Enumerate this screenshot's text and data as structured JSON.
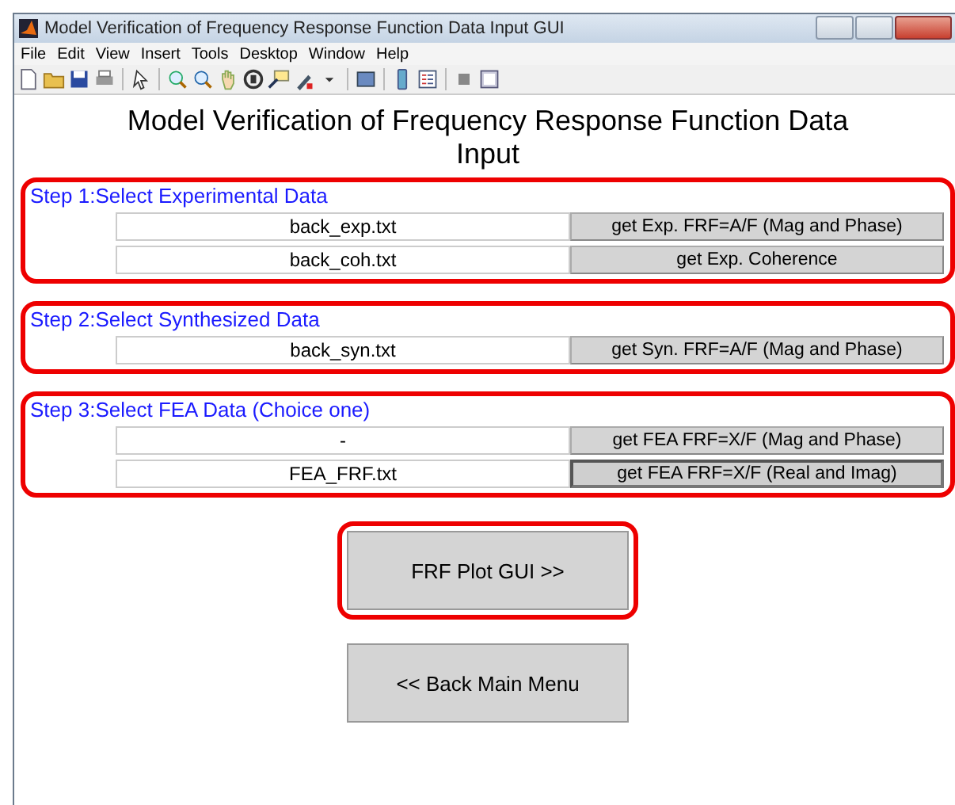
{
  "window": {
    "title": "Model Verification of Frequency Response Function Data Input GUI"
  },
  "menu": [
    "File",
    "Edit",
    "View",
    "Insert",
    "Tools",
    "Desktop",
    "Window",
    "Help"
  ],
  "heading": "Model Verification of Frequency Response Function Data Input",
  "steps": [
    {
      "title": "Step 1:Select Experimental Data",
      "rows": [
        {
          "value": "back_exp.txt",
          "button": "get Exp. FRF=A/F (Mag and Phase)",
          "pressed": false
        },
        {
          "value": "back_coh.txt",
          "button": "get Exp. Coherence",
          "pressed": false
        }
      ]
    },
    {
      "title": "Step 2:Select Synthesized Data",
      "rows": [
        {
          "value": "back_syn.txt",
          "button": "get Syn. FRF=A/F (Mag and Phase)",
          "pressed": false
        }
      ]
    },
    {
      "title": "Step 3:Select FEA Data (Choice one)",
      "rows": [
        {
          "value": "-",
          "button": "get FEA FRF=X/F (Mag and Phase)",
          "pressed": false
        },
        {
          "value": "FEA_FRF.txt",
          "button": "get FEA FRF=X/F (Real and Imag)",
          "pressed": true
        }
      ]
    }
  ],
  "buttons": [
    {
      "label": "FRF Plot GUI >>",
      "highlighted": true
    },
    {
      "label": "<< Back Main Menu",
      "highlighted": false
    }
  ]
}
